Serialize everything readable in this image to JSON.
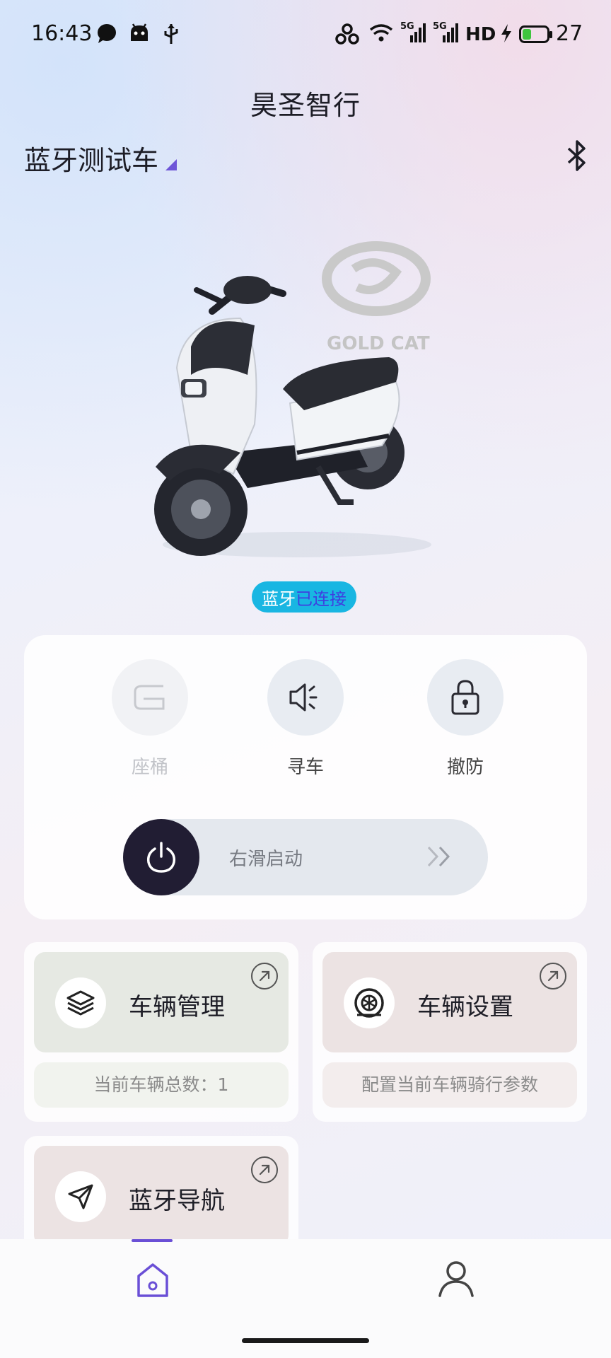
{
  "status_bar": {
    "time": "16:43",
    "network_1": "5G",
    "network_2": "5G",
    "hd": "HD",
    "battery": "27"
  },
  "header": {
    "app_title": "昊圣智行",
    "vehicle_name": "蓝牙测试车",
    "bluetooth_icon": "bluetooth-icon"
  },
  "hero": {
    "brand_logo_text": "GOLD CAT",
    "bt_status_prefix": "蓝牙",
    "bt_status_value": "已连接"
  },
  "controls": {
    "buttons": [
      {
        "label": "座桶",
        "icon": "seat-icon",
        "enabled": false
      },
      {
        "label": "寻车",
        "icon": "speaker-icon",
        "enabled": true
      },
      {
        "label": "撤防",
        "icon": "lock-icon",
        "enabled": true
      }
    ],
    "slider_label": "右滑启动"
  },
  "tiles": [
    {
      "title": "车辆管理",
      "subtitle": "当前车辆总数：1",
      "icon": "layers-icon"
    },
    {
      "title": "车辆设置",
      "subtitle": "配置当前车辆骑行参数",
      "icon": "tire-icon"
    },
    {
      "title": "蓝牙导航",
      "icon": "send-icon"
    }
  ],
  "colors": {
    "accent": "#6a4fd6",
    "badge": "#19b6e2",
    "knob": "#211d33"
  }
}
